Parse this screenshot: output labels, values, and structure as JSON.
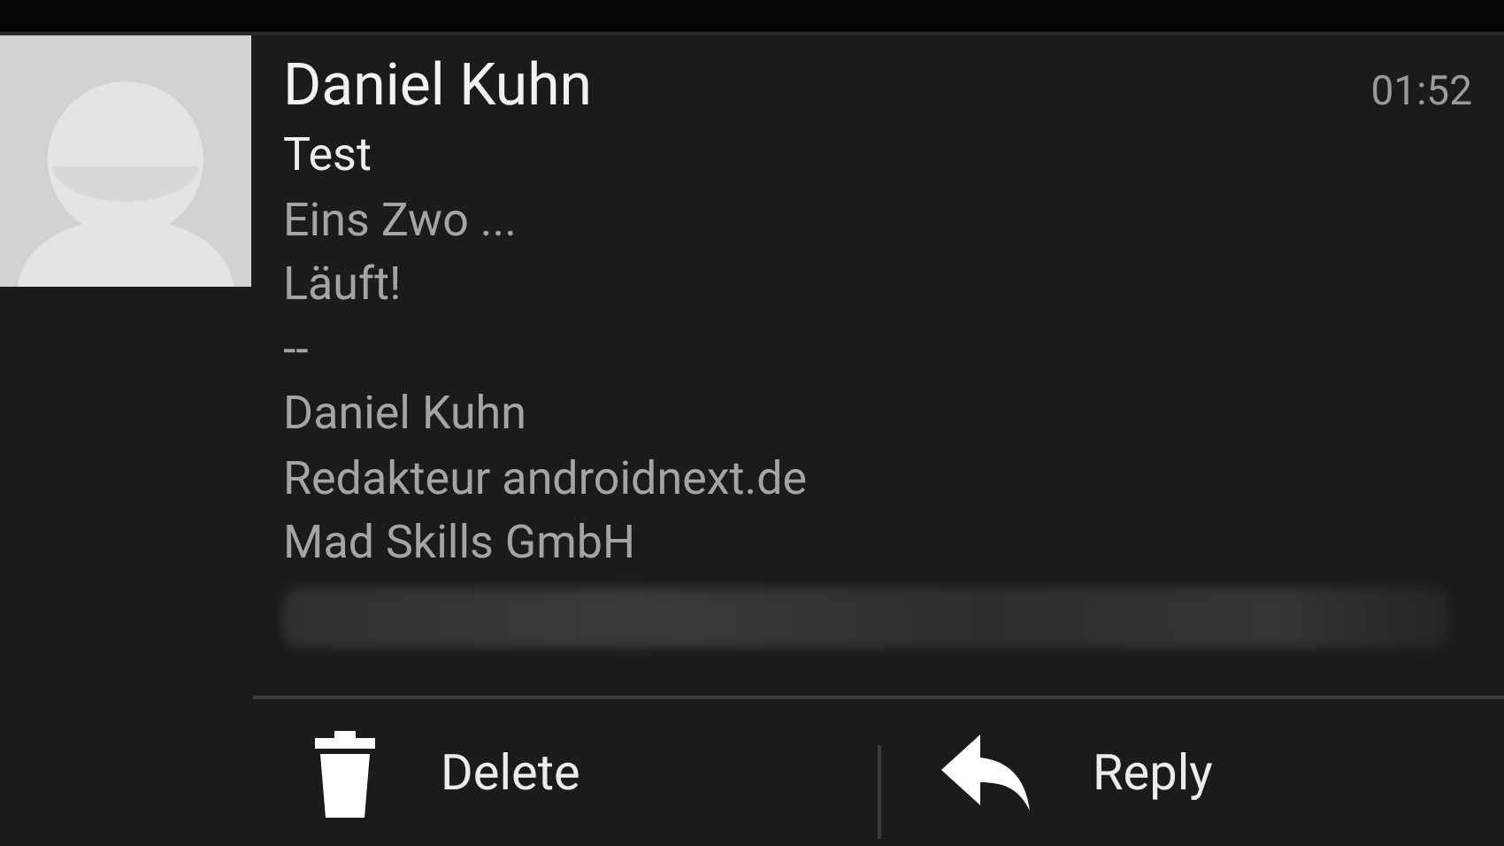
{
  "notification": {
    "sender": "Daniel Kuhn",
    "time": "01:52",
    "subject": "Test",
    "body_lines": [
      "Eins Zwo ...",
      "Läuft!",
      "--",
      "Daniel Kuhn",
      "Redakteur androidnext.de",
      "Mad Skills GmbH"
    ],
    "redacted_line": {
      "kind": "blurred"
    }
  },
  "actions": [
    {
      "kind": "delete",
      "label": "Delete"
    },
    {
      "kind": "reply",
      "label": "Reply"
    }
  ]
}
